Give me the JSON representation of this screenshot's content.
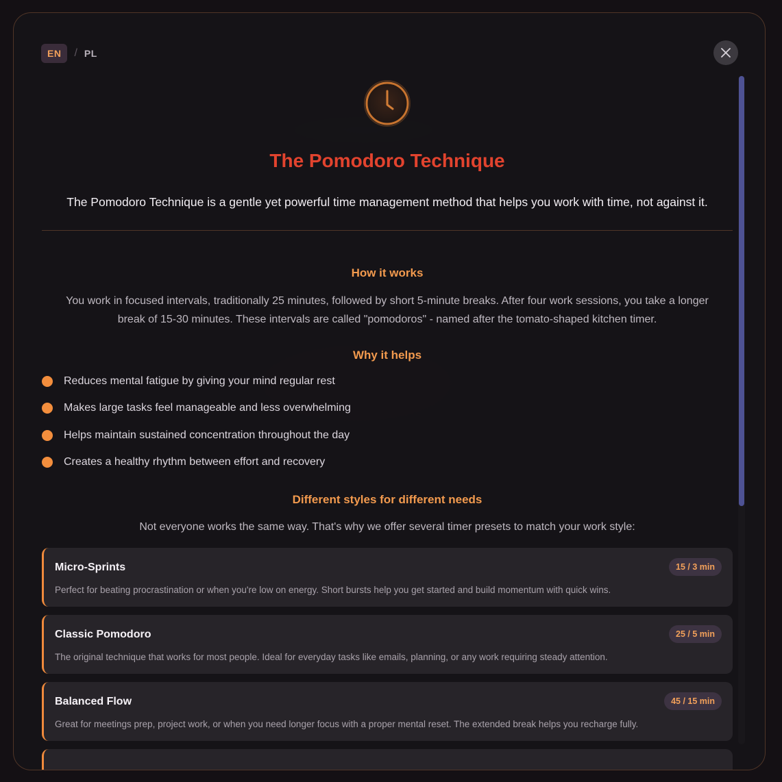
{
  "language": {
    "active": "EN",
    "separator": "/",
    "other": "PL"
  },
  "modal": {
    "title": "The Pomodoro Technique",
    "intro": "The Pomodoro Technique is a gentle yet powerful time management method that helps you work with time, not against it."
  },
  "how_it_works": {
    "heading": "How it works",
    "line1": "You work in focused intervals, traditionally 25 minutes, followed by short 5-minute breaks. After four work sessions, you take a longer",
    "line2": "break of 15-30 minutes. These intervals are called \"pomodoros\" - named after the tomato-shaped kitchen timer."
  },
  "why_it_helps": {
    "heading": "Why it helps",
    "items": [
      "Reduces mental fatigue by giving your mind regular rest",
      "Makes large tasks feel manageable and less overwhelming",
      "Helps maintain sustained concentration throughout the day",
      "Creates a healthy rhythm between effort and recovery"
    ]
  },
  "styles": {
    "heading": "Different styles for different needs",
    "intro": "Not everyone works the same way. That's why we offer several timer presets to match your work style:",
    "presets": [
      {
        "name": "Micro-Sprints",
        "badge": "15 / 3 min",
        "desc": "Perfect for beating procrastination or when you're low on energy. Short bursts help you get started and build momentum with quick wins."
      },
      {
        "name": "Classic Pomodoro",
        "badge": "25 / 5 min",
        "desc": "The original technique that works for most people. Ideal for everyday tasks like emails, planning, or any work requiring steady attention."
      },
      {
        "name": "Balanced Flow",
        "badge": "45 / 15 min",
        "desc": "Great for meetings prep, project work, or when you need longer focus with a proper mental reset. The extended break helps you recharge fully."
      }
    ]
  },
  "colors": {
    "accent": "#f29a4e",
    "title": "#e2432e",
    "scrollbar": "#4e5294"
  },
  "icons": {
    "header": "clock-icon",
    "close": "close-icon"
  }
}
